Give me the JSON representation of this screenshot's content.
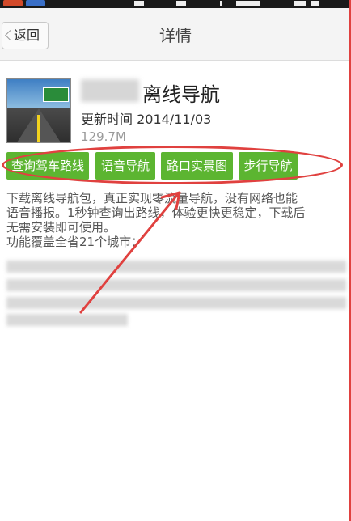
{
  "header": {
    "back_label": "返回",
    "title": "详情"
  },
  "app": {
    "name": "离线导航",
    "update_time": "更新时间 2014/11/03",
    "size": "129.7M"
  },
  "actions": [
    "查询驾车路线",
    "语音导航",
    "路口实景图",
    "步行导航"
  ],
  "description": {
    "line1": "下载离线导航包，真正实现零流量导航，没有网络也能",
    "line2": "语音播报。1秒钟查询出路线，体验更快更稳定，下载后",
    "line3": "无需安装即可使用。",
    "line4": "功能覆盖全省21个城市："
  },
  "colors": {
    "action_button": "#5cb531",
    "annotation": "#e0413f",
    "header_bg": "#f4f4f4"
  },
  "icons": [
    "chevron-left-icon",
    "app-icon"
  ]
}
